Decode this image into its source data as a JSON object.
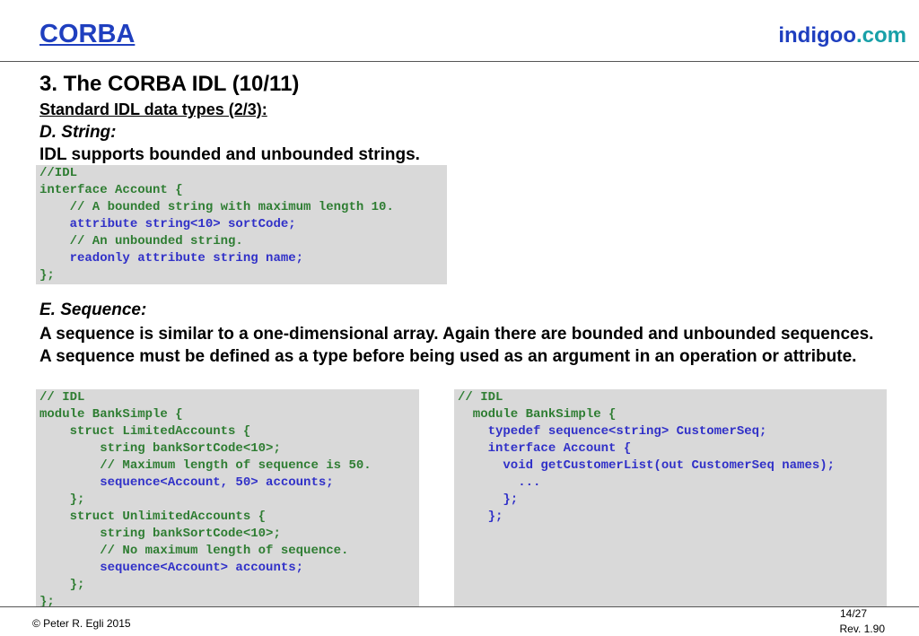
{
  "header": {
    "title": "CORBA",
    "brand_main": "indigoo",
    "brand_tld": ".com"
  },
  "slide": {
    "title": "3. The CORBA IDL (10/11)",
    "subtitle": "Standard IDL data types (2/3):",
    "section_d": {
      "heading": "D. String:",
      "text": "IDL supports bounded and unbounded strings."
    },
    "section_e": {
      "heading": "E. Sequence:",
      "text": "A sequence is similar to a one-dimensional array. Again there are bounded and unbounded sequences. A sequence must be defined as a type before being used as an argument in an operation or attribute."
    }
  },
  "code_string": [
    {
      "text": "//IDL",
      "color": "#2e7d32"
    },
    {
      "text": "interface Account {",
      "color": "#2e7d32"
    },
    {
      "text": "    // A bounded string with maximum length 10.",
      "color": "#2e7d32"
    },
    {
      "text": "    attribute string<10> sortCode;",
      "color": "#3030c8"
    },
    {
      "text": "    // An unbounded string.",
      "color": "#2e7d32"
    },
    {
      "text": "    readonly attribute string name;",
      "color": "#3030c8"
    },
    {
      "text": "};",
      "color": "#2e7d32"
    }
  ],
  "code_seq_left": [
    {
      "text": "// IDL",
      "color": "#2e7d32"
    },
    {
      "text": "module BankSimple {",
      "color": "#2e7d32"
    },
    {
      "text": "    struct LimitedAccounts {",
      "color": "#2e7d32"
    },
    {
      "text": "        string bankSortCode<10>;",
      "color": "#2e7d32"
    },
    {
      "text": "        // Maximum length of sequence is 50.",
      "color": "#2e7d32"
    },
    {
      "text": "        sequence<Account, 50> accounts;",
      "color": "#3030c8"
    },
    {
      "text": "    };",
      "color": "#2e7d32"
    },
    {
      "text": "    struct UnlimitedAccounts {",
      "color": "#2e7d32"
    },
    {
      "text": "        string bankSortCode<10>;",
      "color": "#2e7d32"
    },
    {
      "text": "        // No maximum length of sequence.",
      "color": "#2e7d32"
    },
    {
      "text": "        sequence<Account> accounts;",
      "color": "#3030c8"
    },
    {
      "text": "    };",
      "color": "#2e7d32"
    },
    {
      "text": "};",
      "color": "#2e7d32"
    }
  ],
  "code_seq_right": [
    {
      "text": "// IDL",
      "color": "#2e7d32"
    },
    {
      "text": "  module BankSimple {",
      "color": "#2e7d32"
    },
    {
      "text": "    typedef sequence<string> CustomerSeq;",
      "color": "#3030c8"
    },
    {
      "text": "    interface Account {",
      "color": "#3030c8"
    },
    {
      "text": "      void getCustomerList(out CustomerSeq names);",
      "color": "#3030c8"
    },
    {
      "text": "        ...",
      "color": "#3030c8"
    },
    {
      "text": "      };",
      "color": "#3030c8"
    },
    {
      "text": "    };",
      "color": "#3030c8"
    }
  ],
  "footer": {
    "copyright": "© Peter R. Egli 2015",
    "page": "14/27",
    "revision": "Rev. 1.90"
  }
}
